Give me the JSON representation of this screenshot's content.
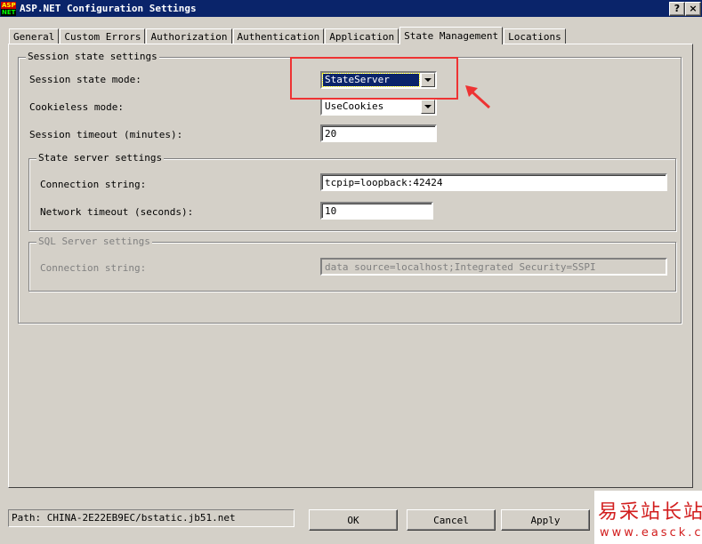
{
  "window": {
    "icon_top": "ASP",
    "icon_bottom": "NET",
    "title": "ASP.NET Configuration Settings",
    "help_label": "?",
    "close_label": "×"
  },
  "tabs": [
    {
      "label": "General"
    },
    {
      "label": "Custom Errors"
    },
    {
      "label": "Authorization"
    },
    {
      "label": "Authentication"
    },
    {
      "label": "Application"
    },
    {
      "label": "State Management"
    },
    {
      "label": "Locations"
    }
  ],
  "session": {
    "legend": "Session state settings",
    "mode_label": "Session state mode:",
    "mode_value": "StateServer",
    "cookieless_label": "Cookieless mode:",
    "cookieless_value": "UseCookies",
    "timeout_label": "Session timeout (minutes):",
    "timeout_value": "20"
  },
  "state_server": {
    "legend": "State server settings",
    "conn_label": "Connection string:",
    "conn_value": "tcpip=loopback:42424",
    "net_timeout_label": "Network timeout (seconds):",
    "net_timeout_value": "10"
  },
  "sql_server": {
    "legend": "SQL Server settings",
    "conn_label": "Connection string:",
    "conn_value": "data source=localhost;Integrated Security=SSPI"
  },
  "footer": {
    "path": "Path: CHINA-2E22EB9EC/bstatic.jb51.net",
    "ok_label": "OK",
    "cancel_label": "Cancel",
    "apply_label": "Apply"
  },
  "watermark": {
    "chinese": "易采站长站",
    "domain": "www.easck.com"
  },
  "colors": {
    "titlebar": "#0a246a",
    "highlight": "#e33333",
    "watermark": "#d21e1e"
  }
}
